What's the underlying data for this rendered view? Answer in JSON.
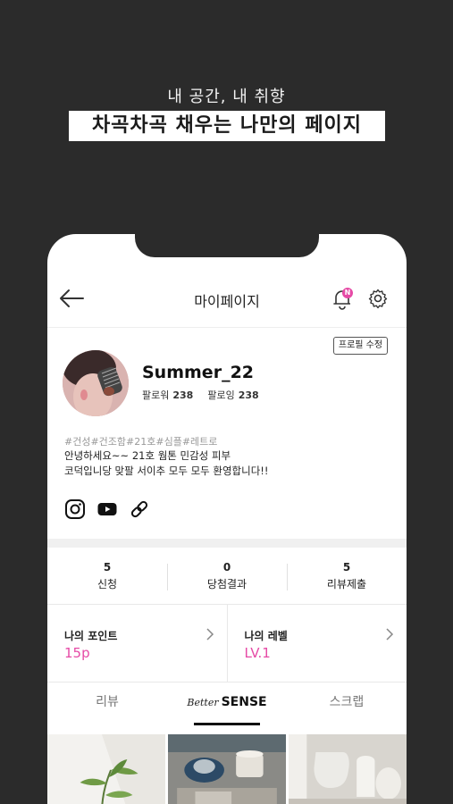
{
  "promo": {
    "subtitle": "내 공간, 내 취향",
    "headline": "차곡차곡 채우는 나만의 페이지"
  },
  "header": {
    "title": "마이페이지",
    "bell_badge": "N"
  },
  "profile": {
    "edit_label": "프로필 수정",
    "username": "Summer_22",
    "followers_label": "팔로워",
    "followers_count": "238",
    "following_label": "팔로잉",
    "following_count": "238",
    "hashtags": "#건성#건조함#21호#심플#레트로",
    "bio_line1": "안녕하세요~~ 21호 웜톤 민감성 피부",
    "bio_line2": "코덕입니당 맞팔 서이추 모두 모두 환영합니다!!",
    "social_icons": [
      "instagram-icon",
      "youtube-icon",
      "link-icon"
    ]
  },
  "stats": [
    {
      "value": "5",
      "label": "신청"
    },
    {
      "value": "0",
      "label": "당첨결과"
    },
    {
      "value": "5",
      "label": "리뷰제출"
    }
  ],
  "points": {
    "point_title": "나의 포인트",
    "point_value": "15p",
    "level_title": "나의 레벨",
    "level_value": "LV.1"
  },
  "tabs": {
    "review": "리뷰",
    "brand_script": "Better",
    "brand_bold": "SENSE",
    "scrap": "스크랩",
    "active": "brand"
  },
  "colors": {
    "accent": "#e64aa6",
    "background": "#2b2b2b"
  }
}
